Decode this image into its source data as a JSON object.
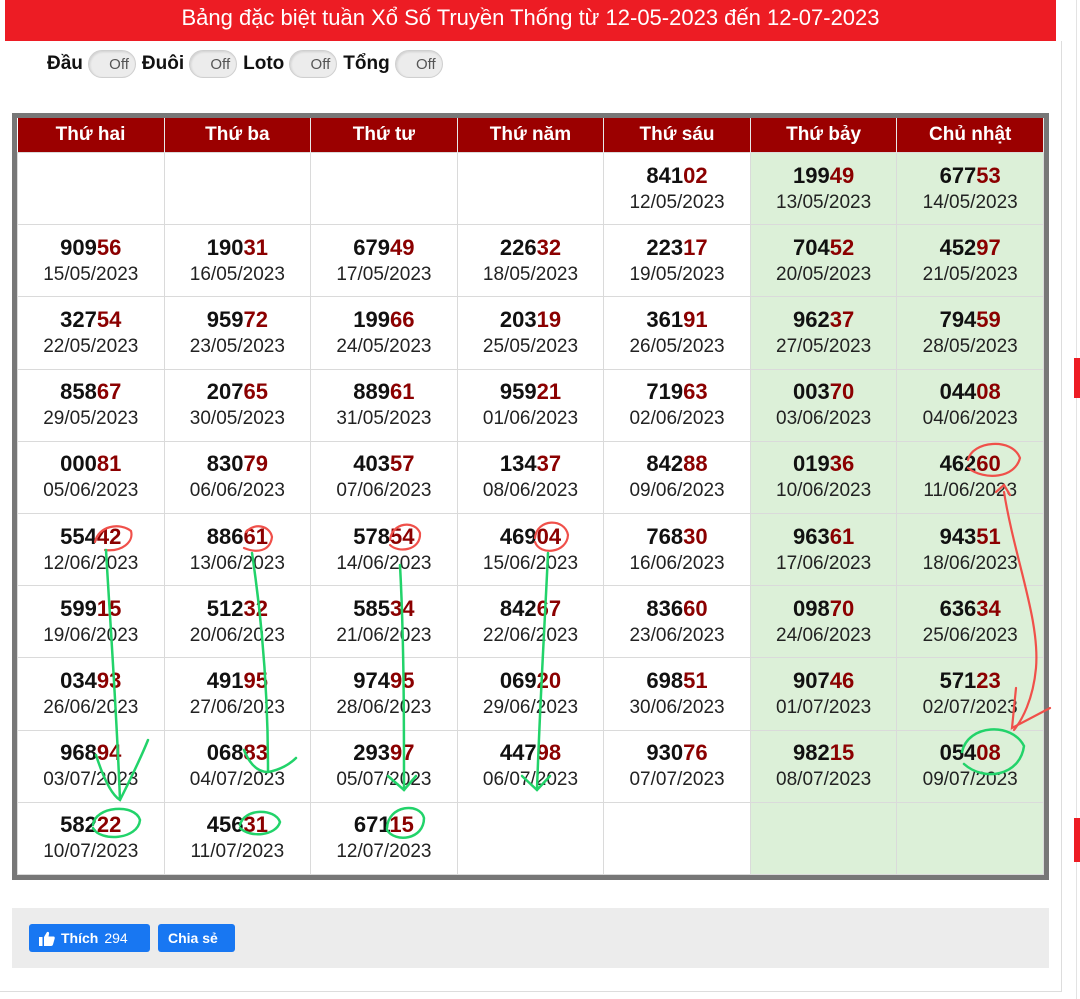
{
  "title": "Bảng đặc biệt tuần Xổ Số Truyền Thống từ 12-05-2023 đến 12-07-2023",
  "toggles": [
    {
      "label": "Đầu",
      "state": "Off"
    },
    {
      "label": "Đuôi",
      "state": "Off"
    },
    {
      "label": "Loto",
      "state": "Off"
    },
    {
      "label": "Tổng",
      "state": "Off"
    }
  ],
  "headers": [
    "Thứ hai",
    "Thứ ba",
    "Thứ tư",
    "Thứ năm",
    "Thứ sáu",
    "Thứ bảy",
    "Chủ nhật"
  ],
  "rows": [
    [
      null,
      null,
      null,
      null,
      {
        "head": "841",
        "tail": "02",
        "date": "12/05/2023"
      },
      {
        "head": "199",
        "tail": "49",
        "date": "13/05/2023"
      },
      {
        "head": "677",
        "tail": "53",
        "date": "14/05/2023"
      }
    ],
    [
      {
        "head": "909",
        "tail": "56",
        "date": "15/05/2023"
      },
      {
        "head": "190",
        "tail": "31",
        "date": "16/05/2023"
      },
      {
        "head": "679",
        "tail": "49",
        "date": "17/05/2023"
      },
      {
        "head": "226",
        "tail": "32",
        "date": "18/05/2023"
      },
      {
        "head": "223",
        "tail": "17",
        "date": "19/05/2023"
      },
      {
        "head": "704",
        "tail": "52",
        "date": "20/05/2023"
      },
      {
        "head": "452",
        "tail": "97",
        "date": "21/05/2023"
      }
    ],
    [
      {
        "head": "327",
        "tail": "54",
        "date": "22/05/2023"
      },
      {
        "head": "959",
        "tail": "72",
        "date": "23/05/2023"
      },
      {
        "head": "199",
        "tail": "66",
        "date": "24/05/2023"
      },
      {
        "head": "203",
        "tail": "19",
        "date": "25/05/2023"
      },
      {
        "head": "361",
        "tail": "91",
        "date": "26/05/2023"
      },
      {
        "head": "962",
        "tail": "37",
        "date": "27/05/2023"
      },
      {
        "head": "794",
        "tail": "59",
        "date": "28/05/2023"
      }
    ],
    [
      {
        "head": "858",
        "tail": "67",
        "date": "29/05/2023"
      },
      {
        "head": "207",
        "tail": "65",
        "date": "30/05/2023"
      },
      {
        "head": "889",
        "tail": "61",
        "date": "31/05/2023"
      },
      {
        "head": "959",
        "tail": "21",
        "date": "01/06/2023"
      },
      {
        "head": "719",
        "tail": "63",
        "date": "02/06/2023"
      },
      {
        "head": "003",
        "tail": "70",
        "date": "03/06/2023"
      },
      {
        "head": "044",
        "tail": "08",
        "date": "04/06/2023"
      }
    ],
    [
      {
        "head": "000",
        "tail": "81",
        "date": "05/06/2023"
      },
      {
        "head": "830",
        "tail": "79",
        "date": "06/06/2023"
      },
      {
        "head": "403",
        "tail": "57",
        "date": "07/06/2023"
      },
      {
        "head": "134",
        "tail": "37",
        "date": "08/06/2023"
      },
      {
        "head": "842",
        "tail": "88",
        "date": "09/06/2023"
      },
      {
        "head": "019",
        "tail": "36",
        "date": "10/06/2023"
      },
      {
        "head": "462",
        "tail": "60",
        "date": "11/06/2023"
      }
    ],
    [
      {
        "head": "554",
        "tail": "42",
        "date": "12/06/2023"
      },
      {
        "head": "886",
        "tail": "61",
        "date": "13/06/2023"
      },
      {
        "head": "578",
        "tail": "54",
        "date": "14/06/2023"
      },
      {
        "head": "469",
        "tail": "04",
        "date": "15/06/2023"
      },
      {
        "head": "768",
        "tail": "30",
        "date": "16/06/2023"
      },
      {
        "head": "963",
        "tail": "61",
        "date": "17/06/2023"
      },
      {
        "head": "943",
        "tail": "51",
        "date": "18/06/2023"
      }
    ],
    [
      {
        "head": "599",
        "tail": "15",
        "date": "19/06/2023"
      },
      {
        "head": "512",
        "tail": "32",
        "date": "20/06/2023"
      },
      {
        "head": "585",
        "tail": "34",
        "date": "21/06/2023"
      },
      {
        "head": "842",
        "tail": "67",
        "date": "22/06/2023"
      },
      {
        "head": "836",
        "tail": "60",
        "date": "23/06/2023"
      },
      {
        "head": "098",
        "tail": "70",
        "date": "24/06/2023"
      },
      {
        "head": "636",
        "tail": "34",
        "date": "25/06/2023"
      }
    ],
    [
      {
        "head": "034",
        "tail": "93",
        "date": "26/06/2023"
      },
      {
        "head": "491",
        "tail": "95",
        "date": "27/06/2023"
      },
      {
        "head": "974",
        "tail": "95",
        "date": "28/06/2023"
      },
      {
        "head": "069",
        "tail": "20",
        "date": "29/06/2023"
      },
      {
        "head": "698",
        "tail": "51",
        "date": "30/06/2023"
      },
      {
        "head": "907",
        "tail": "46",
        "date": "01/07/2023"
      },
      {
        "head": "571",
        "tail": "23",
        "date": "02/07/2023"
      }
    ],
    [
      {
        "head": "968",
        "tail": "94",
        "date": "03/07/2023"
      },
      {
        "head": "068",
        "tail": "83",
        "date": "04/07/2023"
      },
      {
        "head": "293",
        "tail": "97",
        "date": "05/07/2023"
      },
      {
        "head": "447",
        "tail": "98",
        "date": "06/07/2023"
      },
      {
        "head": "930",
        "tail": "76",
        "date": "07/07/2023"
      },
      {
        "head": "982",
        "tail": "15",
        "date": "08/07/2023"
      },
      {
        "head": "054",
        "tail": "08",
        "date": "09/07/2023"
      }
    ],
    [
      {
        "head": "582",
        "tail": "22",
        "date": "10/07/2023"
      },
      {
        "head": "456",
        "tail": "31",
        "date": "11/07/2023"
      },
      {
        "head": "671",
        "tail": "15",
        "date": "12/07/2023"
      },
      null,
      null,
      null,
      null
    ]
  ],
  "footer": {
    "like_label": "Thích",
    "like_count": "294",
    "share_label": "Chia sẻ"
  },
  "colors": {
    "title_bg": "#ed1c24",
    "header_bg": "#9b0000",
    "tail_text": "#8b0000",
    "weekend_bg": "#dcf0d8",
    "annotation_red": "#f0504a",
    "annotation_green": "#22d36a"
  }
}
